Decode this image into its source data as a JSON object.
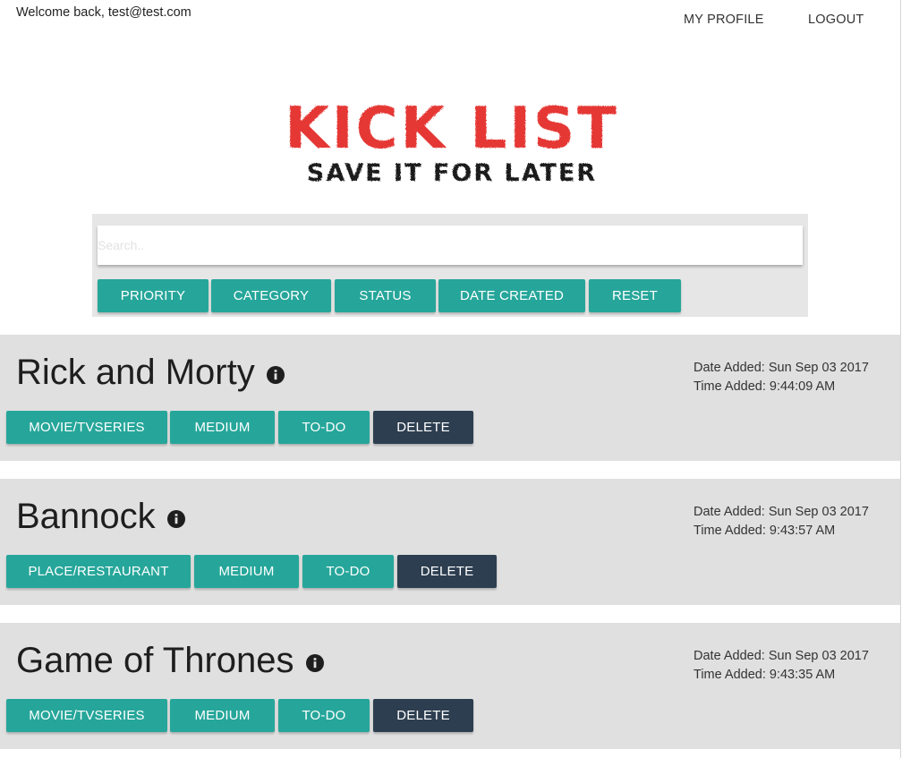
{
  "header": {
    "welcome_text": "Welcome back, test@test.com",
    "nav": {
      "profile_label": "MY PROFILE",
      "logout_label": "LOGOUT"
    }
  },
  "logo": {
    "title": "KICK LIST",
    "tagline": "SAVE IT FOR LATER",
    "title_color": "#e53935",
    "tagline_color": "#1a1a1a"
  },
  "filters": {
    "search_placeholder": "Search..",
    "buttons": [
      "PRIORITY",
      "CATEGORY",
      "STATUS",
      "DATE CREATED",
      "RESET"
    ]
  },
  "colors": {
    "accent": "#26a69a",
    "delete": "#2d3e50",
    "card_bg": "#e0e0e0",
    "panel_bg": "#e6e6e6"
  },
  "items": [
    {
      "title": "Rick and Morty",
      "date_added": "Date Added: Sun Sep 03 2017",
      "time_added": "Time Added: 9:44:09 AM",
      "category": "MOVIE/TVSERIES",
      "priority": "MEDIUM",
      "status": "TO-DO",
      "delete_label": "DELETE"
    },
    {
      "title": "Bannock",
      "date_added": "Date Added: Sun Sep 03 2017",
      "time_added": "Time Added: 9:43:57 AM",
      "category": "PLACE/RESTAURANT",
      "priority": "MEDIUM",
      "status": "TO-DO",
      "delete_label": "DELETE"
    },
    {
      "title": "Game of Thrones",
      "date_added": "Date Added: Sun Sep 03 2017",
      "time_added": "Time Added: 9:43:35 AM",
      "category": "MOVIE/TVSERIES",
      "priority": "MEDIUM",
      "status": "TO-DO",
      "delete_label": "DELETE"
    }
  ]
}
